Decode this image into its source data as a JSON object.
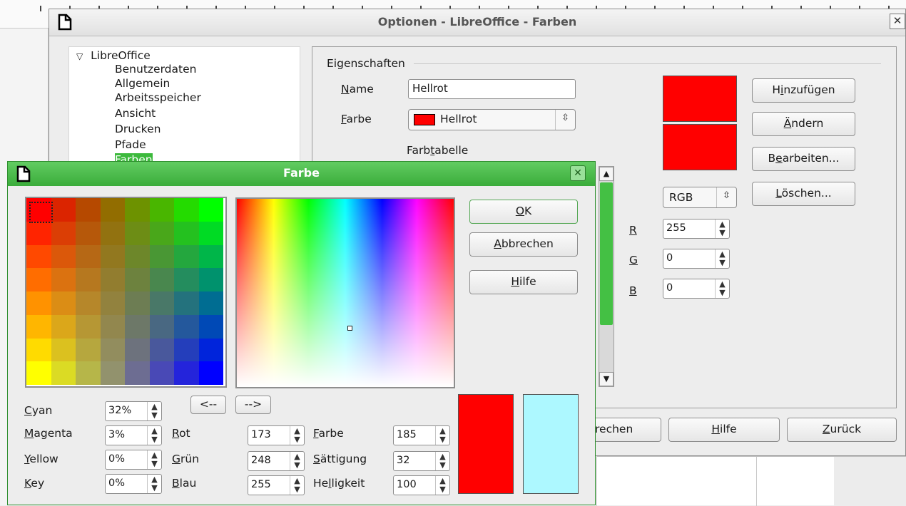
{
  "options_dialog": {
    "title": "Optionen - LibreOffice - Farben",
    "close_label": "✕",
    "tree": {
      "root": "LibreOffice",
      "items": [
        "Benutzerdaten",
        "Allgemein",
        "Arbeitsspeicher",
        "Ansicht",
        "Drucken",
        "Pfade",
        "Farben"
      ]
    },
    "properties": {
      "legend": "Eigenschaften",
      "name_label": "N",
      "name_label_rest": "ame",
      "name_value": "Hellrot",
      "farbe_label": "F",
      "farbe_label_rest": "arbe",
      "farbe_value": "Hellrot",
      "table_label_a": "Farb",
      "table_label_u": "t",
      "table_label_b": "abelle",
      "model_value": "RGB",
      "r_label": "R",
      "g_label": "G",
      "b_label": "B",
      "r_value": "255",
      "g_value": "0",
      "b_value": "0",
      "preview_color": "#ff0000"
    },
    "buttons": {
      "add": {
        "pre": "H",
        "u": "i",
        "post": "nzufügen"
      },
      "change": {
        "pre": "",
        "u": "Ä",
        "post": "ndern"
      },
      "edit": {
        "pre": "B",
        "u": "e",
        "post": "arbeiten..."
      },
      "delete": {
        "pre": "",
        "u": "L",
        "post": "öschen..."
      }
    },
    "footer": {
      "cancel_partial": "rechen",
      "help_u": "H",
      "help_rest": "ilfe",
      "back_u": "Z",
      "back_rest": "urück"
    }
  },
  "farbe_dialog": {
    "title": "Farbe",
    "close_label": "✕",
    "ok_u": "O",
    "ok_rest": "K",
    "cancel_u": "A",
    "cancel_rest": "bbrechen",
    "help_u": "H",
    "help_rest": "ilfe",
    "nav_left": "<--",
    "nav_right": "-->",
    "cmyk": {
      "cyan_u": "C",
      "cyan_rest": "yan",
      "cyan_value": "32%",
      "magenta_u": "M",
      "magenta_rest": "agenta",
      "magenta_value": "3%",
      "yellow_u": "Y",
      "yellow_rest": "ellow",
      "yellow_value": "0%",
      "key_u": "K",
      "key_rest": "ey",
      "key_value": "0%"
    },
    "rgb": {
      "rot_u": "R",
      "rot_rest": "ot",
      "rot_value": "173",
      "gruen_u": "G",
      "gruen_rest": "rün",
      "gruen_value": "248",
      "blau_u": "B",
      "blau_rest": "lau",
      "blau_value": "255"
    },
    "hsb": {
      "farbe_u": "F",
      "farbe_rest": "arbe",
      "farbe_value": "185",
      "saettigung_u": "S",
      "saettigung_rest": "ättigung",
      "saettigung_value": "32",
      "helligkeit_a": "He",
      "helligkeit_u": "l",
      "helligkeit_b": "ligkeit",
      "helligkeit_value": "100"
    },
    "preview_old": "#ff0000",
    "preview_new": "#adf8ff",
    "palette_corners": {
      "top_left": "#ff0000",
      "top_right": "#00ff00",
      "bottom_left": "#ffff00",
      "bottom_right": "#0000ff"
    }
  }
}
